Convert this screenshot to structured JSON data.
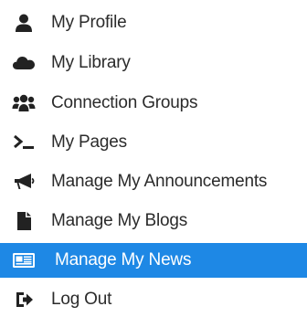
{
  "menu": {
    "items": [
      {
        "label": "My Profile",
        "icon": "user-icon"
      },
      {
        "label": "My Library",
        "icon": "cloud-icon"
      },
      {
        "label": "Connection Groups",
        "icon": "users-icon"
      },
      {
        "label": "My Pages",
        "icon": "terminal-icon"
      },
      {
        "label": "Manage My Announcements",
        "icon": "bullhorn-icon"
      },
      {
        "label": "Manage My Blogs",
        "icon": "file-icon"
      },
      {
        "label": "Manage My News",
        "icon": "newspaper-icon",
        "active": true
      },
      {
        "label": "Log Out",
        "icon": "sign-out-icon"
      }
    ]
  },
  "colors": {
    "active_background": "#1e88e5",
    "icon": "#222222",
    "text": "#2b2b2b",
    "active_text": "#ffffff"
  }
}
